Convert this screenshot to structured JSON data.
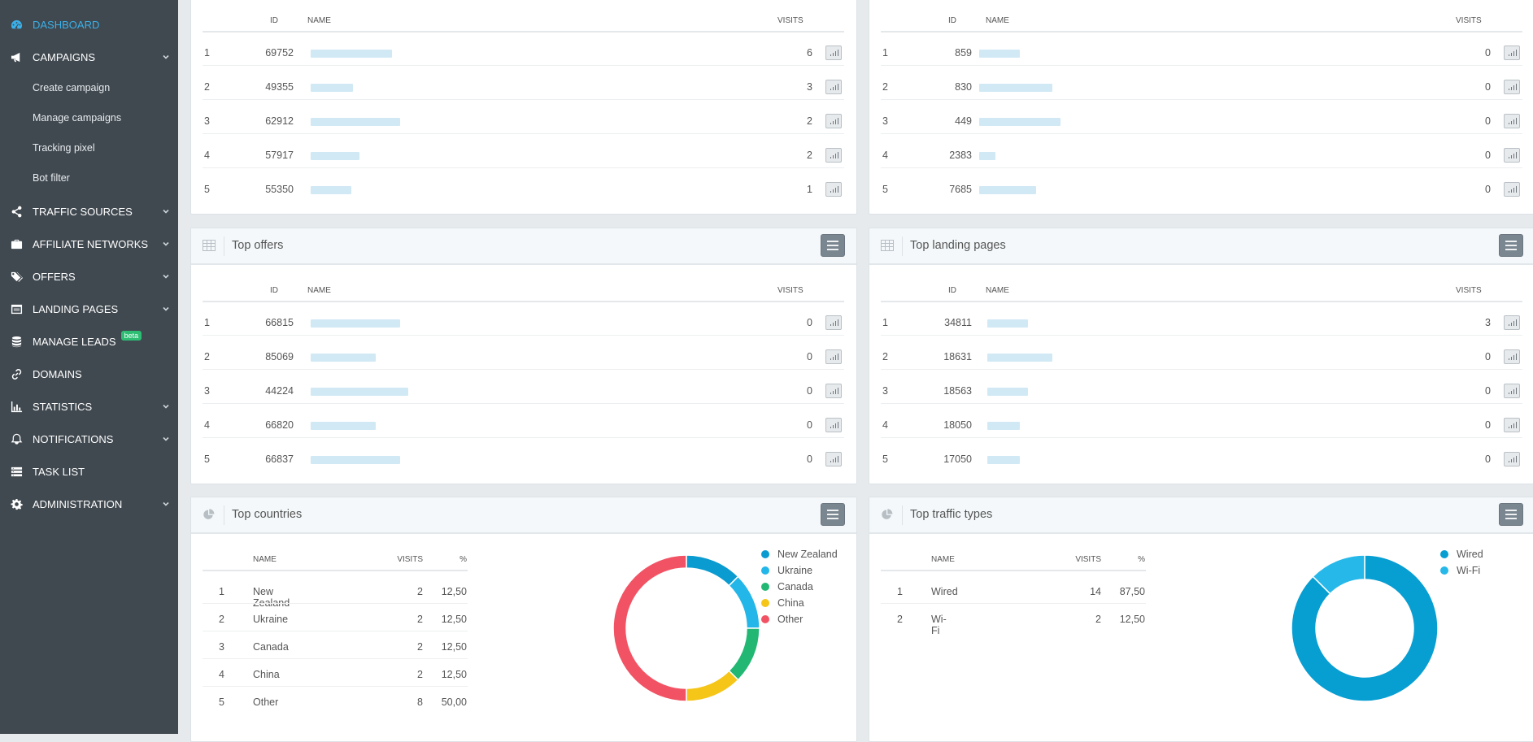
{
  "sidebar": {
    "items": [
      {
        "label": "DASHBOARD",
        "icon": "dashboard-icon",
        "active": true,
        "chevron": false
      },
      {
        "label": "CAMPAIGNS",
        "icon": "megaphone-icon",
        "chevron": true
      },
      {
        "label": "TRAFFIC SOURCES",
        "icon": "share-icon",
        "chevron": true
      },
      {
        "label": "AFFILIATE NETWORKS",
        "icon": "briefcase-icon",
        "chevron": true
      },
      {
        "label": "OFFERS",
        "icon": "tags-icon",
        "chevron": true
      },
      {
        "label": "LANDING PAGES",
        "icon": "window-icon",
        "chevron": true
      },
      {
        "label": "MANAGE LEADS",
        "icon": "database-icon",
        "chevron": false,
        "badge": "beta"
      },
      {
        "label": "DOMAINS",
        "icon": "link-icon",
        "chevron": false
      },
      {
        "label": "STATISTICS",
        "icon": "bar-chart-icon",
        "chevron": true
      },
      {
        "label": "NOTIFICATIONS",
        "icon": "bell-icon",
        "chevron": true
      },
      {
        "label": "TASK LIST",
        "icon": "list-icon",
        "chevron": false
      },
      {
        "label": "ADMINISTRATION",
        "icon": "gear-icon",
        "chevron": true
      }
    ],
    "campaign_subitems": [
      "Create campaign",
      "Manage campaigns",
      "Tracking pixel",
      "Bot filter"
    ]
  },
  "top_left_table": {
    "headers": {
      "id": "ID",
      "name": "NAME",
      "visits": "VISITS"
    },
    "rows": [
      {
        "n": "1",
        "id": "69752",
        "visits": "6"
      },
      {
        "n": "2",
        "id": "49355",
        "visits": "3"
      },
      {
        "n": "3",
        "id": "62912",
        "visits": "2"
      },
      {
        "n": "4",
        "id": "57917",
        "visits": "2"
      },
      {
        "n": "5",
        "id": "55350",
        "visits": "1"
      }
    ]
  },
  "top_right_table": {
    "headers": {
      "id": "ID",
      "name": "NAME",
      "visits": "VISITS"
    },
    "rows": [
      {
        "n": "1",
        "id": "859",
        "visits": "0"
      },
      {
        "n": "2",
        "id": "830",
        "visits": "0"
      },
      {
        "n": "3",
        "id": "449",
        "visits": "0"
      },
      {
        "n": "4",
        "id": "2383",
        "visits": "0"
      },
      {
        "n": "5",
        "id": "7685",
        "visits": "0"
      }
    ]
  },
  "top_offers": {
    "title": "Top offers",
    "headers": {
      "id": "ID",
      "name": "NAME",
      "visits": "VISITS"
    },
    "rows": [
      {
        "n": "1",
        "id": "66815",
        "visits": "0"
      },
      {
        "n": "2",
        "id": "85069",
        "visits": "0"
      },
      {
        "n": "3",
        "id": "44224",
        "visits": "0"
      },
      {
        "n": "4",
        "id": "66820",
        "visits": "0"
      },
      {
        "n": "5",
        "id": "66837",
        "visits": "0"
      }
    ]
  },
  "top_landing_pages": {
    "title": "Top landing pages",
    "headers": {
      "id": "ID",
      "name": "NAME",
      "visits": "VISITS"
    },
    "rows": [
      {
        "n": "1",
        "id": "34811",
        "visits": "3"
      },
      {
        "n": "2",
        "id": "18631",
        "visits": "0"
      },
      {
        "n": "3",
        "id": "18563",
        "visits": "0"
      },
      {
        "n": "4",
        "id": "18050",
        "visits": "0"
      },
      {
        "n": "5",
        "id": "17050",
        "visits": "0"
      }
    ]
  },
  "top_countries": {
    "title": "Top countries",
    "headers": {
      "name": "NAME",
      "visits": "VISITS",
      "pct": "%"
    },
    "rows": [
      {
        "n": "1",
        "name": "New Zealand",
        "visits": "2",
        "pct": "12,50"
      },
      {
        "n": "2",
        "name": "Ukraine",
        "visits": "2",
        "pct": "12,50"
      },
      {
        "n": "3",
        "name": "Canada",
        "visits": "2",
        "pct": "12,50"
      },
      {
        "n": "4",
        "name": "China",
        "visits": "2",
        "pct": "12,50"
      },
      {
        "n": "5",
        "name": "Other",
        "visits": "8",
        "pct": "50,00"
      }
    ]
  },
  "top_traffic_types": {
    "title": "Top traffic types",
    "headers": {
      "name": "NAME",
      "visits": "VISITS",
      "pct": "%"
    },
    "rows": [
      {
        "n": "1",
        "name": "Wired",
        "visits": "14",
        "pct": "87,50"
      },
      {
        "n": "2",
        "name": "Wi-Fi",
        "visits": "2",
        "pct": "12,50"
      }
    ]
  },
  "chart_data": [
    {
      "type": "pie",
      "categories": [
        "New Zealand",
        "Ukraine",
        "Canada",
        "China",
        "Other"
      ],
      "values": [
        2,
        2,
        2,
        2,
        8
      ],
      "colors": [
        "#0a9bd0",
        "#23b6e8",
        "#22b873",
        "#f5c518",
        "#f25364"
      ],
      "legend": "right"
    },
    {
      "type": "pie",
      "categories": [
        "Wired",
        "Wi-Fi"
      ],
      "values": [
        14,
        2
      ],
      "colors": [
        "#079ed2",
        "#27b8ea"
      ],
      "legend": "right"
    }
  ]
}
